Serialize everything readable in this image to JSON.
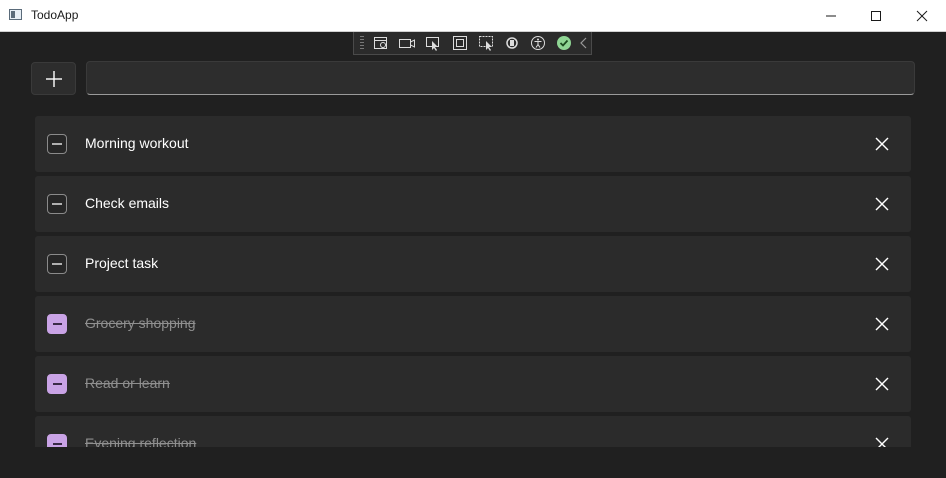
{
  "window": {
    "title": "TodoApp"
  },
  "toolbar": {
    "add_label": "+",
    "input_value": "",
    "input_placeholder": ""
  },
  "items": [
    {
      "label": "Morning workout",
      "done": false
    },
    {
      "label": "Check emails",
      "done": false
    },
    {
      "label": "Project task",
      "done": false
    },
    {
      "label": "Grocery shopping",
      "done": true
    },
    {
      "label": "Read or learn",
      "done": true
    },
    {
      "label": "Evening reflection",
      "done": true
    }
  ],
  "colors": {
    "accent": "#c9a3e6",
    "background": "#202020",
    "item": "#2b2b2b"
  },
  "icons": [
    "app-icon",
    "minimize-icon",
    "maximize-icon",
    "close-icon",
    "add-icon",
    "delete-icon",
    "checkbox-icon"
  ]
}
